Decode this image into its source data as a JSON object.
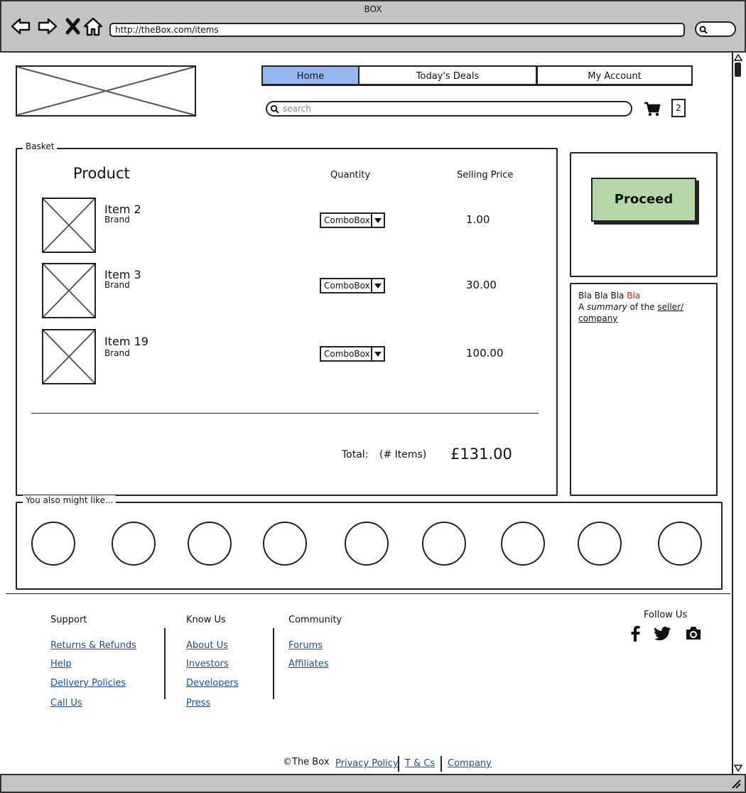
{
  "browser": {
    "title": "BOX",
    "url": "http://theBox.com/items"
  },
  "nav": {
    "tabs": [
      {
        "label": "Home",
        "selected": true
      },
      {
        "label": "Today's Deals"
      },
      {
        "label": "My Account"
      }
    ]
  },
  "search": {
    "placeholder": "search"
  },
  "cart": {
    "count": "2"
  },
  "basket": {
    "label": "Basket",
    "columns": {
      "product": "Product",
      "quantity": "Quantity",
      "price": "Selling Price"
    },
    "items": [
      {
        "name": "Item 2",
        "brand": "Brand",
        "quantity": "ComboBox",
        "price": "1.00"
      },
      {
        "name": "Item 3",
        "brand": "Brand",
        "quantity": "ComboBox",
        "price": "30.00"
      },
      {
        "name": "Item 19",
        "brand": "Brand",
        "quantity": "ComboBox",
        "price": "100.00"
      }
    ],
    "total_label": "Total:",
    "items_label": "(# Items)",
    "total_value": "£131.00"
  },
  "proceed": {
    "label": "Proceed"
  },
  "seller": {
    "line1": "Bla Bla Bla",
    "line1_red": "Bla",
    "line2_a": "A",
    "line2_em": "summary",
    "line2_b": "of the",
    "link1": "seller/",
    "link2": "company"
  },
  "recommend": {
    "label": "You also might like..."
  },
  "footer": {
    "support": {
      "heading": "Support",
      "links": [
        "Returns & Refunds",
        "Help",
        "Delivery Policies",
        "Call Us"
      ]
    },
    "know": {
      "heading": "Know Us",
      "links": [
        "About Us",
        "Investors",
        "Developers",
        "Press"
      ]
    },
    "community": {
      "heading": "Community",
      "links": [
        "Forums",
        "Affiliates"
      ]
    },
    "follow": {
      "heading": "Follow Us",
      "icons": [
        "facebook-icon",
        "twitter-icon",
        "camera-icon"
      ]
    },
    "copyright": "The Box",
    "bottom_links": [
      "Privacy Policy",
      "T & Cs",
      "Company"
    ]
  }
}
